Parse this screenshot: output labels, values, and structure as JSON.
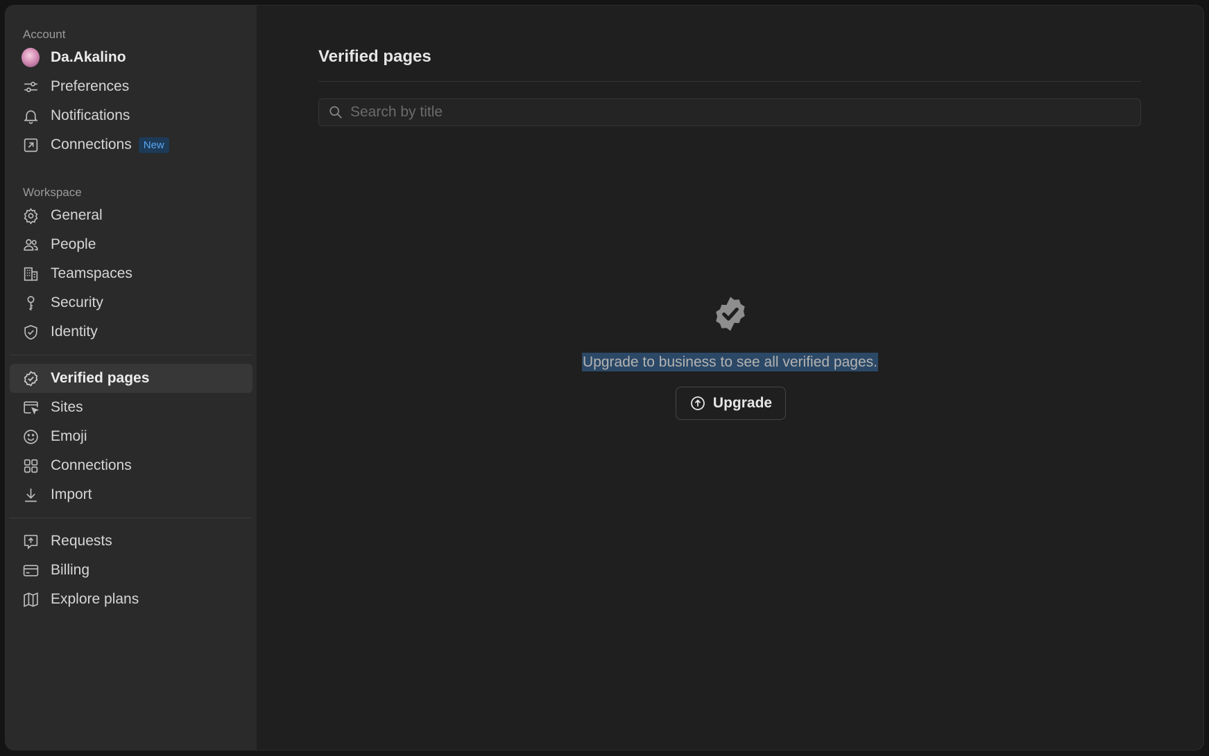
{
  "sidebar": {
    "account_label": "Account",
    "user_name": "Da.Akalino",
    "account_items": [
      {
        "label": "Preferences",
        "icon": "sliders-icon"
      },
      {
        "label": "Notifications",
        "icon": "bell-icon"
      },
      {
        "label": "Connections",
        "icon": "arrow-square-icon",
        "badge": "New"
      }
    ],
    "workspace_label": "Workspace",
    "workspace_items": [
      {
        "label": "General",
        "icon": "gear-icon"
      },
      {
        "label": "People",
        "icon": "people-icon"
      },
      {
        "label": "Teamspaces",
        "icon": "building-icon"
      },
      {
        "label": "Security",
        "icon": "key-icon"
      },
      {
        "label": "Identity",
        "icon": "shield-check-icon"
      }
    ],
    "feature_items": [
      {
        "label": "Verified pages",
        "icon": "verified-badge-icon",
        "active": true
      },
      {
        "label": "Sites",
        "icon": "browser-cursor-icon"
      },
      {
        "label": "Emoji",
        "icon": "smiley-icon"
      },
      {
        "label": "Connections",
        "icon": "grid-icon"
      },
      {
        "label": "Import",
        "icon": "download-icon"
      }
    ],
    "billing_items": [
      {
        "label": "Requests",
        "icon": "request-icon"
      },
      {
        "label": "Billing",
        "icon": "credit-card-icon"
      },
      {
        "label": "Explore plans",
        "icon": "map-icon"
      }
    ]
  },
  "main": {
    "title": "Verified pages",
    "search_placeholder": "Search by title",
    "empty_message": "Upgrade to business to see all verified pages.",
    "upgrade_label": "Upgrade"
  },
  "colors": {
    "sidebar_bg": "#2a2a2a",
    "main_bg": "#1f1f1f",
    "badge_text": "#5aa6f0",
    "selection": "#2b4866"
  }
}
